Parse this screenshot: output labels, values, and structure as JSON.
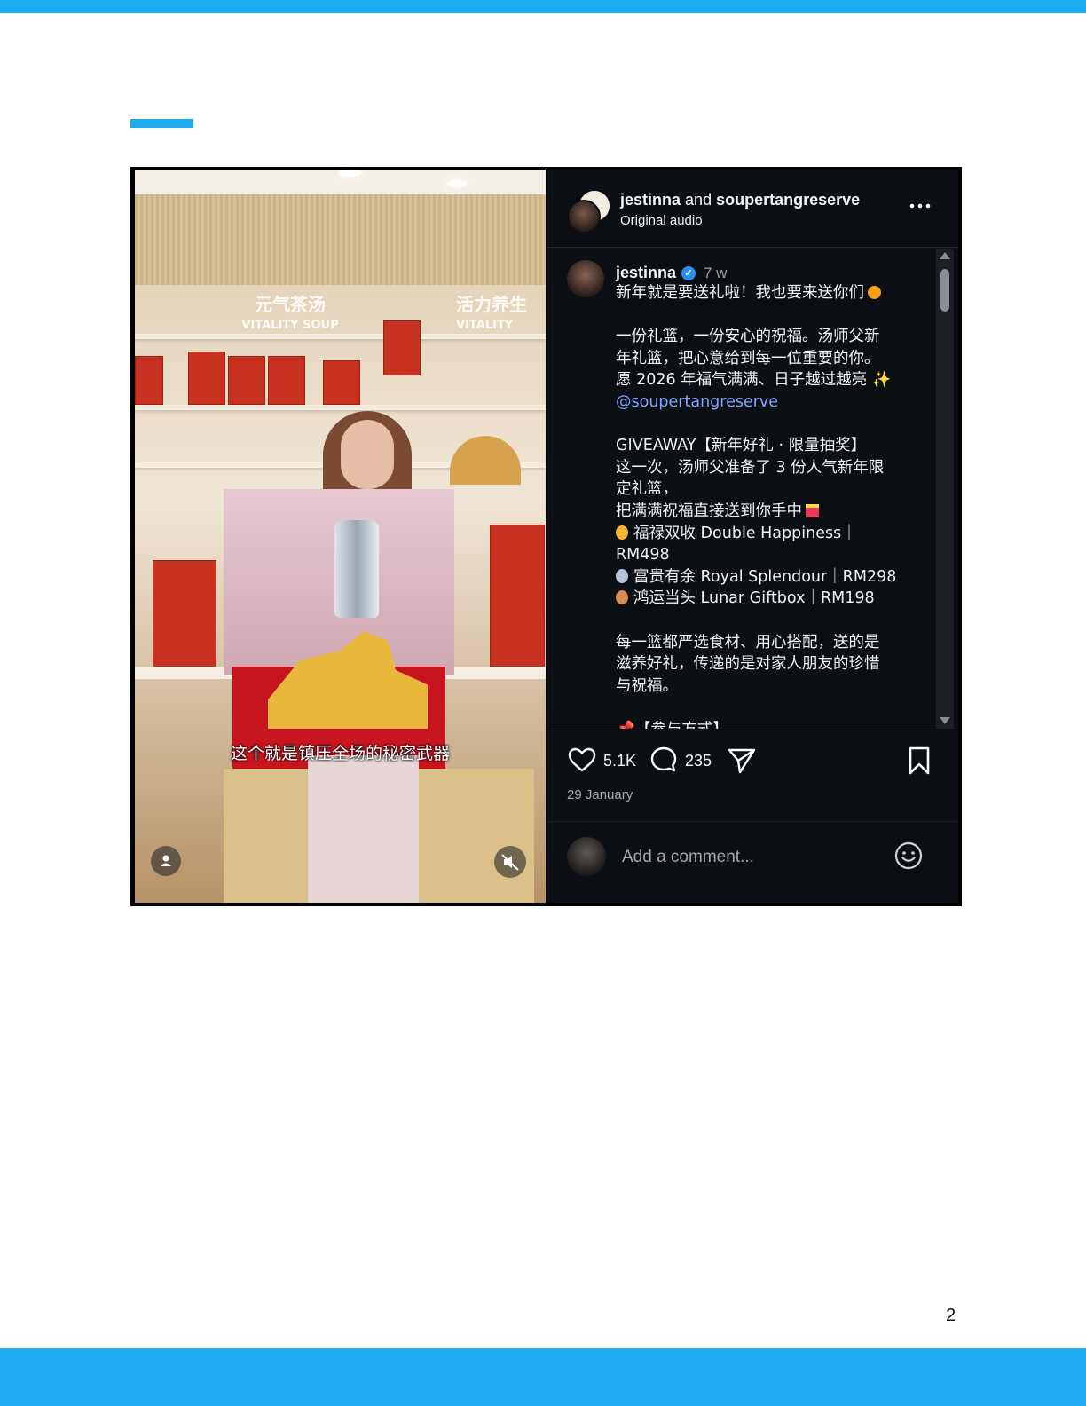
{
  "header": {
    "user1": "jestinna",
    "conj": "and",
    "user2": "soupertangreserve",
    "audio": "Original audio"
  },
  "caption": {
    "username": "jestinna",
    "time": "7 w",
    "lines": {
      "l1": "新年就是要送礼啦！我也要来送你们",
      "l2": "一份礼篮，一份安心的祝福。汤师父新",
      "l3": "年礼篮，把心意给到每一位重要的你。",
      "l4": "愿 2026 年福气满满、日子越过越亮",
      "mention": "@soupertangreserve",
      "l5": "GIVEAWAY【新年好礼 · 限量抽奖】",
      "l6": "这一次，汤师父准备了 3 份人气新年限",
      "l7": "定礼篮，",
      "l8": "把满满祝福直接送到你手中",
      "p1": "福禄双收 Double Happiness｜",
      "p1b": "RM498",
      "p2": "富贵有余 Royal Splendour｜RM298",
      "p3": "鸿运当头 Lunar Giftbox｜RM198",
      "l9": "每一篮都严选食材、用心搭配，送的是",
      "l10": "滋养好礼，传递的是对家人朋友的珍惜",
      "l11": "与祝福。",
      "l12": "【参与方式】"
    }
  },
  "actions": {
    "likes": "5.1K",
    "comments": "235",
    "date": "29 January"
  },
  "comment_box": {
    "placeholder": "Add a comment..."
  },
  "video": {
    "subtitle": "这个就是镇压全场的秘密武器",
    "sign_left_1": "元气茶汤",
    "sign_left_2": "VITALITY SOUP",
    "sign_right_1": "活力养生",
    "sign_right_2": "VITALITY"
  },
  "page": {
    "number": "2"
  },
  "colors": {
    "accent": "#1eabef",
    "panel_bg": "#0c0f14",
    "mention": "#7fa6ff",
    "verified": "#2d8ef2"
  },
  "icons": [
    "heart-icon",
    "comment-icon",
    "share-icon",
    "bookmark-icon",
    "emoji-icon",
    "more-icon",
    "user-icon",
    "muted-icon",
    "verified-icon"
  ]
}
